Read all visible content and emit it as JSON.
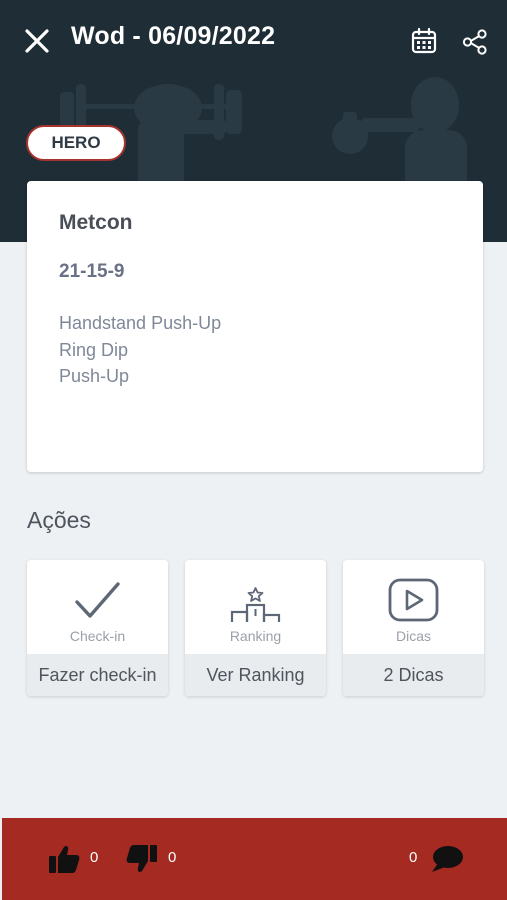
{
  "header": {
    "title": "Wod - 06/09/2022",
    "close_icon": "close-icon",
    "calendar_icon": "calendar-icon",
    "share_icon": "share-icon",
    "background_color": "#1f2d36"
  },
  "badge": {
    "label": "HERO",
    "border_color": "#a8332e"
  },
  "workout": {
    "title": "Metcon",
    "scheme": "21-15-9",
    "movements": [
      "Handstand Push-Up",
      "Ring Dip",
      "Push-Up"
    ]
  },
  "actions_section": {
    "title": "Ações",
    "items": [
      {
        "icon": "check-icon",
        "label": "Check-in",
        "button": "Fazer check-in"
      },
      {
        "icon": "podium-icon",
        "label": "Ranking",
        "button": "Ver Ranking"
      },
      {
        "icon": "play-icon",
        "label": "Dicas",
        "button": "2 Dicas"
      }
    ]
  },
  "footer": {
    "background_color": "#a42a22",
    "likes": "0",
    "dislikes": "0",
    "comments": "0"
  }
}
